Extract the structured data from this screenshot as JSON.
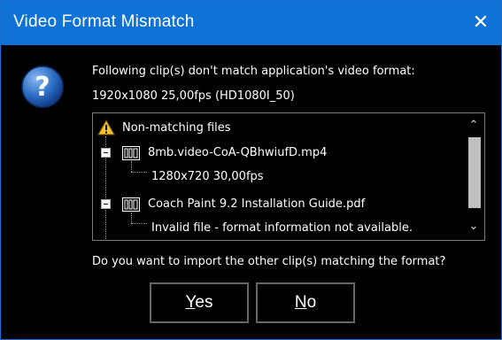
{
  "window": {
    "title": "Video Format Mismatch",
    "close_glyph": "✕",
    "close_icon": "close-icon"
  },
  "message": {
    "line1": "Following clip(s) don't match application's video format:",
    "line2": "1920x1080 25,00fps (HD1080I_50)",
    "question": "Do you want to import the other clip(s) matching the format?"
  },
  "tree": {
    "root_label": "Non-matching files",
    "root_icon": "warning-icon",
    "items": [
      {
        "file": "8mb.video-CoA-QBhwiufD.mp4",
        "detail": "1280x720 30,00fps"
      },
      {
        "file": "Coach Paint 9.2 Installation Guide.pdf",
        "detail": "Invalid file - format information not available."
      }
    ],
    "scroll_up": "⌃",
    "scroll_down": "⌄"
  },
  "buttons": {
    "yes_mnemonic": "Y",
    "yes_rest": "es",
    "no_mnemonic": "N",
    "no_rest": "o"
  },
  "colors": {
    "titlebar": "#0e72d6",
    "background": "#000000",
    "text": "#ffffff"
  }
}
